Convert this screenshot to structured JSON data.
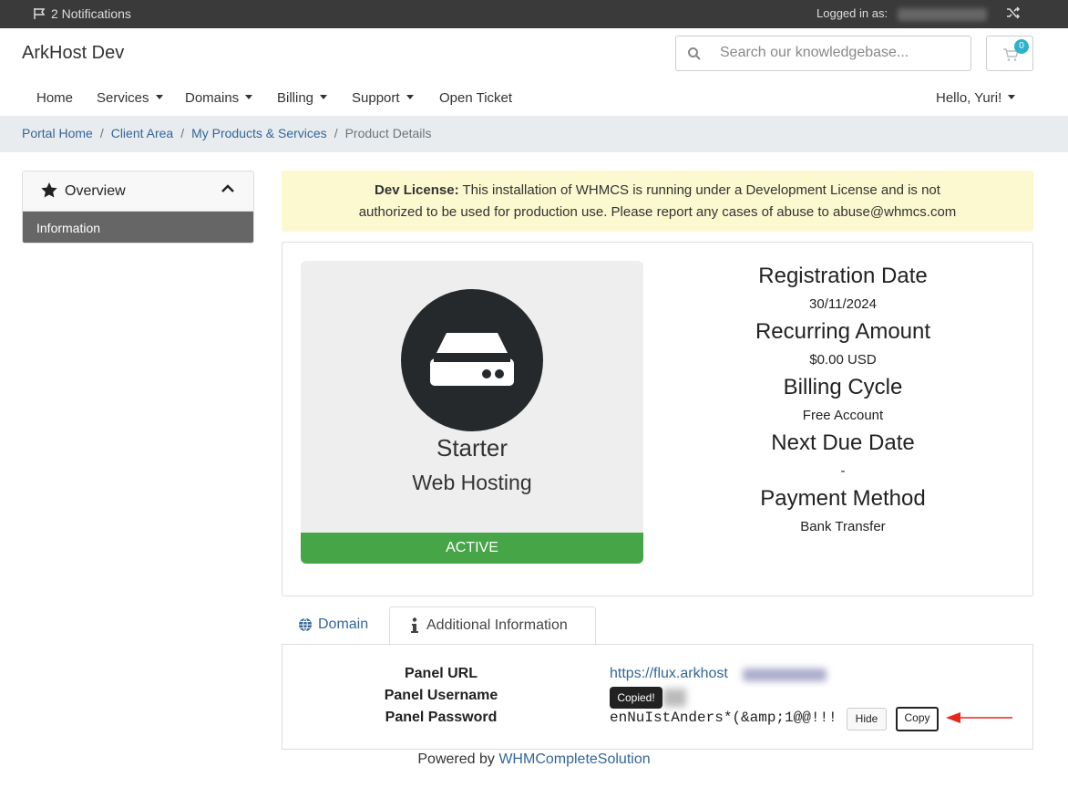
{
  "topbar": {
    "notifications": "2 Notifications",
    "logged_in": "Logged in as:"
  },
  "header": {
    "brand": "ArkHost Dev",
    "search_placeholder": "Search our knowledgebase...",
    "cart_count": "0"
  },
  "nav": {
    "items": [
      "Home",
      "Services",
      "Domains",
      "Billing",
      "Support",
      "Open Ticket"
    ],
    "account": "Hello, Yuri!"
  },
  "breadcrumb": [
    "Portal Home",
    "Client Area",
    "My Products & Services",
    "Product Details"
  ],
  "sidebar": {
    "title": "Overview",
    "items": [
      "Information"
    ]
  },
  "alert": {
    "strong": "Dev License:",
    "line1": "This installation of WHMCS is running under a Development License and is not",
    "line2": "authorized to be used for production use. Please report any cases of abuse to abuse@whmcs.com"
  },
  "product": {
    "name": "Starter",
    "group": "Web Hosting",
    "status": "ACTIVE",
    "details": [
      {
        "label": "Registration Date",
        "value": "30/11/2024"
      },
      {
        "label": "Recurring Amount",
        "value": "$0.00 USD"
      },
      {
        "label": "Billing Cycle",
        "value": "Free Account"
      },
      {
        "label": "Next Due Date",
        "value": "-"
      },
      {
        "label": "Payment Method",
        "value": "Bank Transfer"
      }
    ]
  },
  "tabs": {
    "domain": "Domain",
    "additional": "Additional Information"
  },
  "additional": {
    "panel_url_label": "Panel URL",
    "panel_url_value": "https://flux.arkhost",
    "panel_username_label": "Panel Username",
    "panel_password_label": "Panel Password",
    "panel_password_value": "enNuIstAnders*(&amp;1@@!!!",
    "hide_button": "Hide",
    "copy_button": "Copy",
    "tooltip": "Copied!"
  },
  "footer": {
    "prefix": "Powered by",
    "link": "WHMCompleteSolution"
  },
  "colors": {
    "status_active": "#46a546",
    "link": "#336699",
    "alert_bg": "#fcf8cf",
    "annotation_arrow": "#e8261a"
  }
}
